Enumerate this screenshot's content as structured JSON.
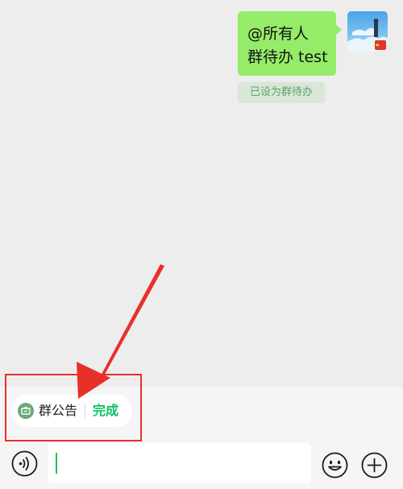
{
  "message": {
    "line1": "@所有人",
    "line2": "群待办 test",
    "status": "已设为群待办"
  },
  "notice_chip": {
    "label": "群公告",
    "done": "完成",
    "icon": "announcement-icon"
  },
  "input": {
    "value": ""
  },
  "icons": {
    "voice": "voice-icon",
    "emoji": "emoji-icon",
    "plus": "plus-icon"
  },
  "colors": {
    "bubble": "#95ec69",
    "accent": "#07c160",
    "annotation": "#e8302a"
  }
}
